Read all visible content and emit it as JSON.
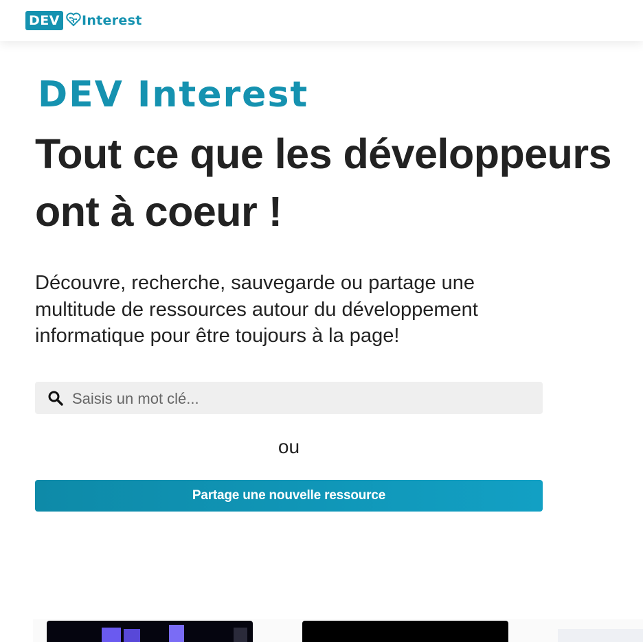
{
  "header": {
    "logo_box_text": "DEV",
    "logo_text": "Interest",
    "logo_icon": "heart-circuit-icon"
  },
  "hero": {
    "brand": "DEV Interest",
    "headline": "Tout ce que les développeurs ont à coeur !",
    "lead": "Découvre, recherche, sauvegarde ou partage une multitude de ressources autour du développement informatique pour être toujours à la page!"
  },
  "search": {
    "icon": "search-icon",
    "placeholder": "Saisis un mot clé...",
    "value": ""
  },
  "separator": "ou",
  "share_button": {
    "label": "Partage une nouvelle ressource"
  },
  "colors": {
    "brand": "#1592b0",
    "text": "#222222",
    "search_bg": "#efefef"
  }
}
